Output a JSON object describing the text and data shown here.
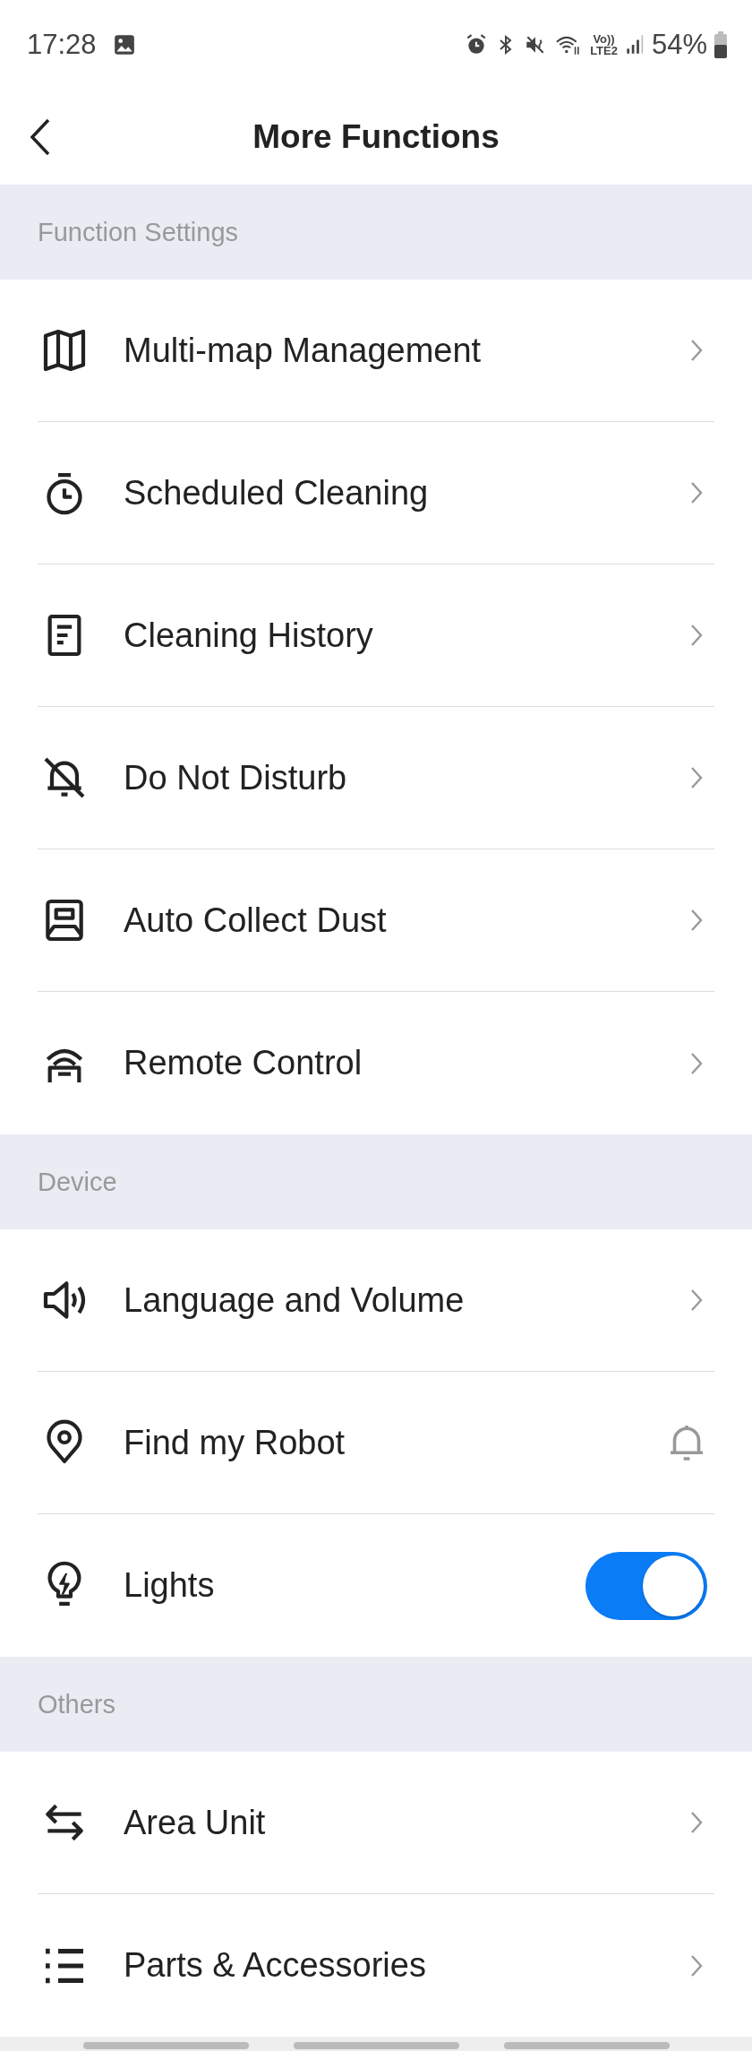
{
  "status_bar": {
    "time": "17:28",
    "volte": "Vo))",
    "network": "LTE2",
    "battery": "54%"
  },
  "header": {
    "title": "More Functions"
  },
  "sections": [
    {
      "title": "Function Settings",
      "rows": [
        {
          "label": "Multi-map Management",
          "kind": "chevron"
        },
        {
          "label": "Scheduled Cleaning",
          "kind": "chevron"
        },
        {
          "label": "Cleaning History",
          "kind": "chevron"
        },
        {
          "label": "Do Not Disturb",
          "kind": "chevron"
        },
        {
          "label": "Auto Collect Dust",
          "kind": "chevron"
        },
        {
          "label": "Remote Control",
          "kind": "chevron"
        }
      ]
    },
    {
      "title": "Device",
      "rows": [
        {
          "label": "Language and Volume",
          "kind": "chevron"
        },
        {
          "label": "Find my Robot",
          "kind": "bell"
        },
        {
          "label": "Lights",
          "kind": "toggle",
          "on": true
        }
      ]
    },
    {
      "title": "Others",
      "rows": [
        {
          "label": "Area Unit",
          "kind": "chevron"
        },
        {
          "label": "Parts & Accessories",
          "kind": "chevron"
        }
      ]
    }
  ]
}
